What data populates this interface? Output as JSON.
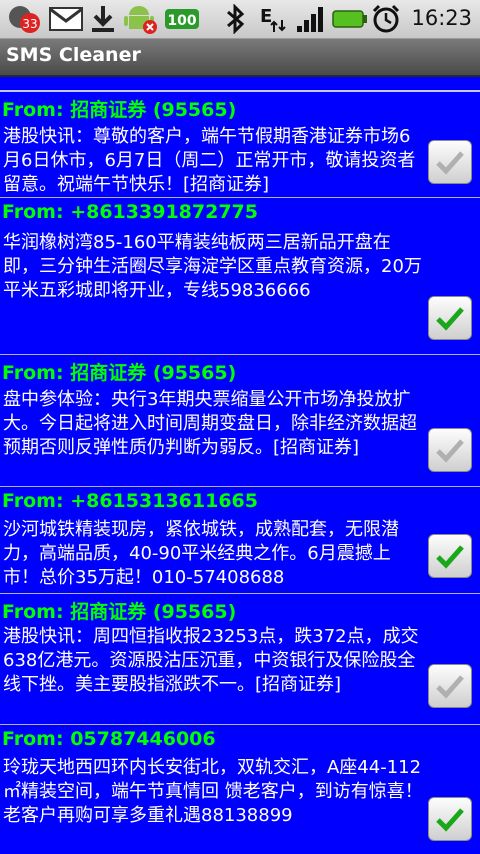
{
  "status_bar": {
    "notification_count": "33",
    "battery_percent": "100",
    "time": "16:23",
    "icons": [
      "unknown-app-icon",
      "gmail-icon",
      "download-icon",
      "android-debug-icon",
      "battery-100-badge-icon",
      "bluetooth-icon",
      "network-e-icon",
      "signal-icon",
      "battery-icon",
      "alarm-icon"
    ]
  },
  "app": {
    "title": "SMS Cleaner"
  },
  "messages": [
    {
      "from": "From: 招商证券 (95565)",
      "body": "港股快讯：尊敬的客户，端午节假期香港证券市场6月6日休市，6月7日（周二）正常开市，敬请投资者留意。祝端午节快乐！[招商证券]",
      "checked": false
    },
    {
      "from": "From: +8613391872775",
      "body": "华润橡树湾85-160平精装纯板两三居新品开盘在即，三分钟生活圈尽享海淀学区重点教育资源，20万平米五彩城即将开业，专线59836666",
      "checked": true
    },
    {
      "from": "From: 招商证券 (95565)",
      "body": "盘中参体验：央行3年期央票缩量公开市场净投放扩大。今日起将进入时间周期变盘日，除非经济数据超预期否则反弹性质仍判断为弱反。[招商证券]",
      "checked": false
    },
    {
      "from": "From: +8615313611665",
      "body": "沙河城铁精装现房，紧依城铁，成熟配套，无限潜力，高端品质，40-90平米经典之作。6月震撼上市！总价35万起！010-57408688",
      "checked": true
    },
    {
      "from": "From: 招商证券 (95565)",
      "body": "港股快讯：周四恒指收报23253点，跌372点，成交638亿港元。资源股沽压沉重，中资银行及保险股全线下挫。美主要股指涨跌不一。[招商证券]",
      "checked": false
    },
    {
      "from": "From: 05787446006",
      "body": "玲珑天地西四环内长安街北，双轨交汇，A座44-112㎡精装空间，端午节真情回 馈老客户，到访有惊喜！老客户再购可享多重礼遇88138899",
      "checked": true
    }
  ]
}
